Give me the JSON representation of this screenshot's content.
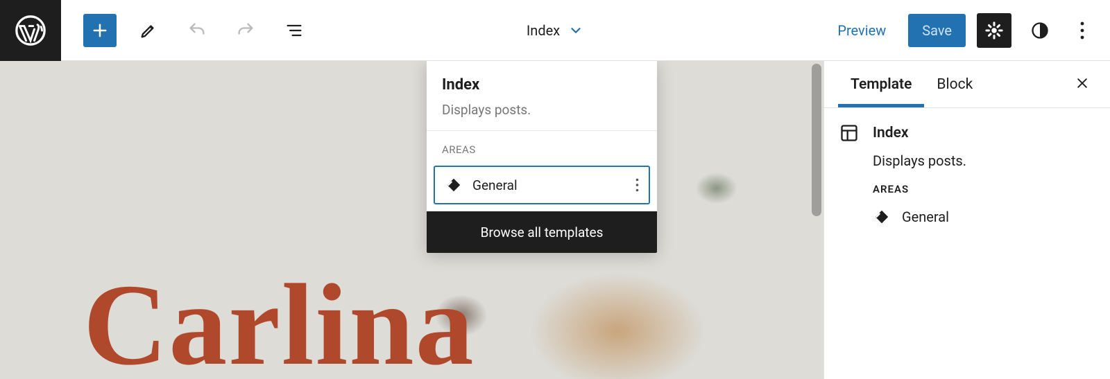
{
  "document": {
    "title": "Index",
    "description": "Displays posts."
  },
  "toolbar": {
    "preview": "Preview",
    "save": "Save"
  },
  "popover": {
    "title": "Index",
    "description": "Displays posts.",
    "areas_label": "AREAS",
    "areas": [
      {
        "label": "General"
      }
    ],
    "browse_all": "Browse all templates"
  },
  "sidebar": {
    "tabs": {
      "template": "Template",
      "block": "Block"
    },
    "title": "Index",
    "description": "Displays posts.",
    "areas_label": "AREAS",
    "areas": [
      {
        "label": "General"
      }
    ]
  },
  "canvas": {
    "site_title": "Carlina"
  }
}
